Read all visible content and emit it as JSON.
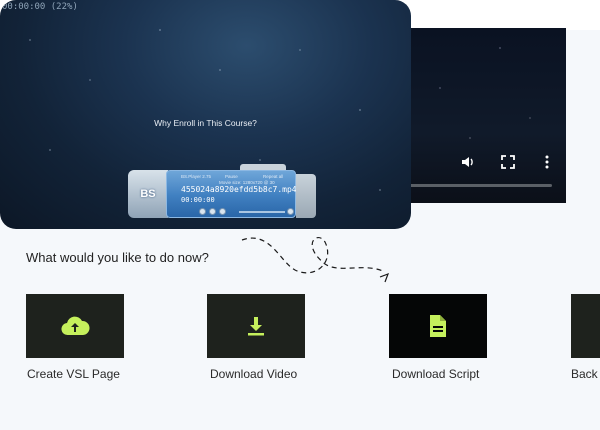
{
  "player": {
    "time_readout": "00:00:00 (22%)",
    "caption": "Why Enroll in This Course?",
    "bs": {
      "logo": "BS",
      "version": "BS.Player 2.75",
      "state": "Pause",
      "repeat": "Repeat all",
      "movie_info": "Movie size: 1280x720 @ 30",
      "filename": "455024a8920efdd5b8c7.mp4",
      "time": "00:00:00"
    }
  },
  "prompt": "What would you like to do now?",
  "actions": [
    {
      "label": "Create VSL Page",
      "icon": "cloud-upload-icon"
    },
    {
      "label": "Download Video",
      "icon": "download-icon"
    },
    {
      "label": "Download Script",
      "icon": "document-icon"
    },
    {
      "label": "Back",
      "icon": ""
    }
  ],
  "colors": {
    "accent": "#c5f05c",
    "card_bg": "#1e221d",
    "panel_bg": "#f5f8fb"
  }
}
